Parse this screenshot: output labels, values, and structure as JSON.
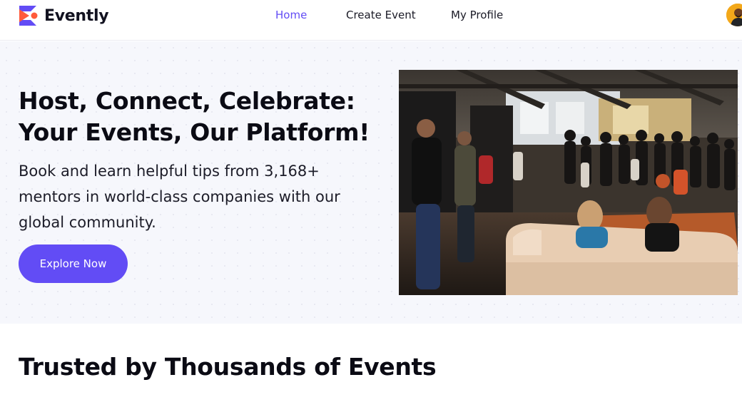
{
  "brand": {
    "name": "Evently"
  },
  "nav": {
    "items": [
      {
        "label": "Home",
        "active": true
      },
      {
        "label": "Create Event",
        "active": false
      },
      {
        "label": "My Profile",
        "active": false
      }
    ]
  },
  "hero": {
    "title": "Host, Connect, Celebrate: Your Events, Our Platform!",
    "subtitle": "Book and learn helpful tips from 3,168+ mentors in world-class companies with our global community.",
    "cta_label": "Explore Now"
  },
  "trusted": {
    "title": "Trusted by Thousands of Events"
  },
  "colors": {
    "primary": "#624cf5",
    "logo_accent": "#ff5a3c",
    "hero_bg": "#f6f7fc"
  },
  "icons": {
    "logo": "evently-logo-icon",
    "avatar": "user-avatar"
  }
}
